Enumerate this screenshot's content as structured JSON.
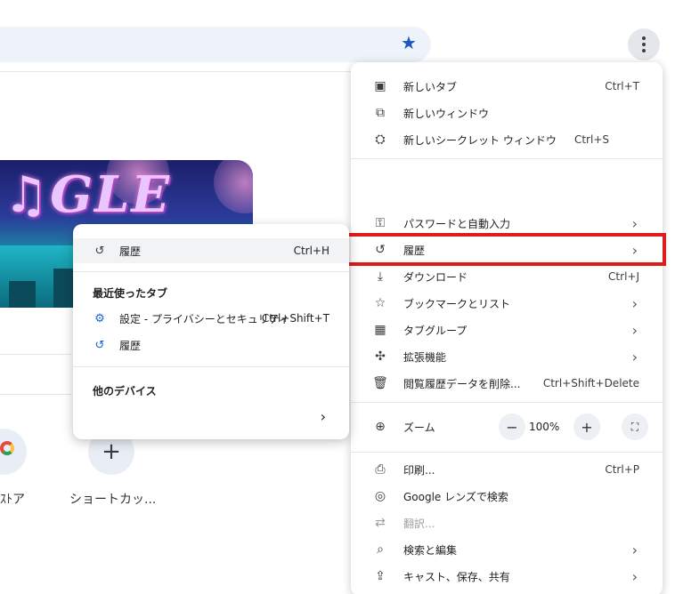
{
  "background": {
    "shortcuts": [
      {
        "label": "ｽﾄア"
      },
      {
        "label": "ショートカッ..."
      }
    ],
    "add_shortcut_glyph": "+",
    "doodle_logo": "♫GLE",
    "star_glyph": "★"
  },
  "menu": {
    "items": [
      {
        "icon": "new-tab-icon",
        "glyph": "▣",
        "label": "新しいタブ",
        "shortcut": "Ctrl+T"
      },
      {
        "icon": "new-window-icon",
        "glyph": "⧉",
        "label": "新しいウィンドウ",
        "shortcut": ""
      },
      {
        "icon": "incognito-icon",
        "glyph": "⛭",
        "label": "新しいシークレット ウィンドウ",
        "shortcut": "Ctrl+S"
      },
      {
        "icon": "key-icon",
        "glyph": "⚿",
        "label": "パスワードと自動入力",
        "chevron": "›"
      },
      {
        "icon": "history-icon",
        "glyph": "↺",
        "label": "履歴",
        "chevron": "›"
      },
      {
        "icon": "download-icon",
        "glyph": "⤓",
        "label": "ダウンロード",
        "shortcut": "Ctrl+J"
      },
      {
        "icon": "bookmark-star-icon",
        "glyph": "☆",
        "label": "ブックマークとリスト",
        "chevron": "›"
      },
      {
        "icon": "tab-groups-icon",
        "glyph": "▦",
        "label": "タブグループ",
        "chevron": "›"
      },
      {
        "icon": "extensions-icon",
        "glyph": "✣",
        "label": "拡張機能",
        "chevron": "›"
      },
      {
        "icon": "trash-icon",
        "glyph": "🗑",
        "label": "閲覧履歴データを削除...",
        "shortcut": "Ctrl+Shift+Delete"
      },
      {
        "icon": "zoom-icon",
        "glyph": "⊕",
        "label": "ズーム"
      },
      {
        "icon": "print-icon",
        "glyph": "⎙",
        "label": "印刷...",
        "shortcut": "Ctrl+P"
      },
      {
        "icon": "google-lens-icon",
        "glyph": "◎",
        "label": "Google レンズで検索"
      },
      {
        "icon": "translate-icon",
        "glyph": "⇄",
        "label": "翻訳..."
      },
      {
        "icon": "find-edit-icon",
        "glyph": "⌕",
        "label": "検索と編集",
        "chevron": "›"
      },
      {
        "icon": "cast-icon",
        "glyph": "⇪",
        "label": "キャスト、保存、共有",
        "chevron": "›"
      }
    ],
    "zoom": {
      "minus": "−",
      "value": "100%",
      "plus": "+",
      "fullscreen": "⛶"
    }
  },
  "history_submenu": {
    "top_item": {
      "glyph": "↺",
      "label": "履歴",
      "shortcut": "Ctrl+H"
    },
    "recent_tabs_heading": "最近使ったタブ",
    "recent_tabs": [
      {
        "icon": "settings-gear-icon",
        "glyph": "⚙",
        "label": "設定 - プライバシーとセキュリティ",
        "shortcut": "Ctrl+Shift+T"
      },
      {
        "icon": "history-icon",
        "glyph": "↺",
        "label": "履歴",
        "shortcut": ""
      }
    ],
    "other_devices_heading": "他のデバイス",
    "other_devices_chevron": "›"
  },
  "colors": {
    "highlight_box": "#e01b1b",
    "accent": "#1a64d6"
  }
}
